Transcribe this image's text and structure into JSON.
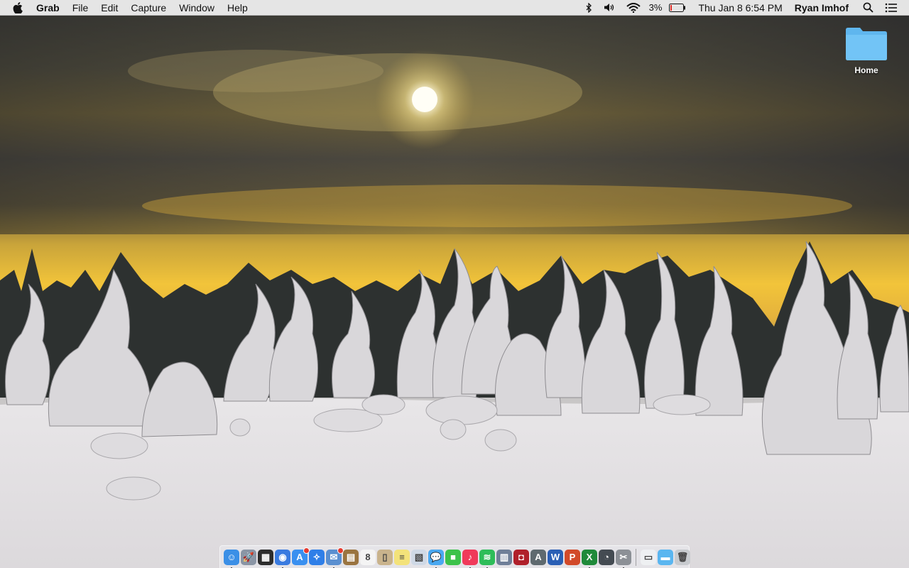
{
  "menubar": {
    "app_name": "Grab",
    "menus": [
      "File",
      "Edit",
      "Capture",
      "Window",
      "Help"
    ],
    "battery_percent": "3%",
    "datetime": "Thu Jan 8  6:54 PM",
    "user": "Ryan Imhof",
    "status_icons": [
      "bluetooth-icon",
      "volume-icon",
      "wifi-icon",
      "battery-icon",
      "spotlight-icon",
      "notification-center-icon"
    ]
  },
  "desktop": {
    "icons": [
      {
        "label": "Home",
        "icon": "folder-icon"
      }
    ]
  },
  "dock": {
    "apps": [
      {
        "name": "finder",
        "color": "#3b8fe6",
        "glyph": "☺",
        "running": true
      },
      {
        "name": "launchpad",
        "color": "#8a95a5",
        "glyph": "🚀",
        "running": false
      },
      {
        "name": "mission-control",
        "color": "#2d2d2d",
        "glyph": "▦",
        "running": false
      },
      {
        "name": "chrome",
        "color": "#3a7be0",
        "glyph": "◉",
        "running": true
      },
      {
        "name": "app-store",
        "color": "#3a90f0",
        "glyph": "A",
        "running": false,
        "badge": true
      },
      {
        "name": "safari",
        "color": "#2f7fe8",
        "glyph": "✧",
        "running": false
      },
      {
        "name": "mail",
        "color": "#5a8fd0",
        "glyph": "✉",
        "running": true,
        "badge": true
      },
      {
        "name": "notefile",
        "color": "#9a7440",
        "glyph": "▤",
        "running": false
      },
      {
        "name": "calendar",
        "color": "#f4f4f4",
        "glyph": "8",
        "running": false
      },
      {
        "name": "contacts",
        "color": "#c9b38c",
        "glyph": "▯",
        "running": false
      },
      {
        "name": "notes",
        "color": "#f3e27a",
        "glyph": "≡",
        "running": false
      },
      {
        "name": "preview",
        "color": "#cfd9e6",
        "glyph": "▧",
        "running": false
      },
      {
        "name": "messages",
        "color": "#4aa8f0",
        "glyph": "💬",
        "running": true
      },
      {
        "name": "facetime",
        "color": "#3cc24a",
        "glyph": "■",
        "running": false
      },
      {
        "name": "itunes",
        "color": "#f03a5a",
        "glyph": "♪",
        "running": true
      },
      {
        "name": "spotify",
        "color": "#2ebd59",
        "glyph": "≋",
        "running": true
      },
      {
        "name": "image-capture",
        "color": "#6f7f98",
        "glyph": "▥",
        "running": false
      },
      {
        "name": "photo-booth",
        "color": "#b0202a",
        "glyph": "◘",
        "running": false
      },
      {
        "name": "font-book",
        "color": "#5f6a6f",
        "glyph": "A",
        "running": false
      },
      {
        "name": "word",
        "color": "#2a5fb5",
        "glyph": "W",
        "running": false
      },
      {
        "name": "powerpoint",
        "color": "#d24a2a",
        "glyph": "P",
        "running": false
      },
      {
        "name": "excel",
        "color": "#1f8a3a",
        "glyph": "X",
        "running": true
      },
      {
        "name": "time-machine",
        "color": "#444b52",
        "glyph": "◔",
        "running": false
      },
      {
        "name": "grab",
        "color": "#8c9096",
        "glyph": "✂",
        "running": true
      }
    ],
    "stacks": [
      {
        "name": "documents-stack",
        "color": "#eef0f2",
        "glyph": "▭"
      },
      {
        "name": "downloads-folder",
        "color": "#5ab6f0",
        "glyph": "▬"
      },
      {
        "name": "trash",
        "color": "#c8cbcf",
        "glyph": "🗑"
      }
    ]
  }
}
